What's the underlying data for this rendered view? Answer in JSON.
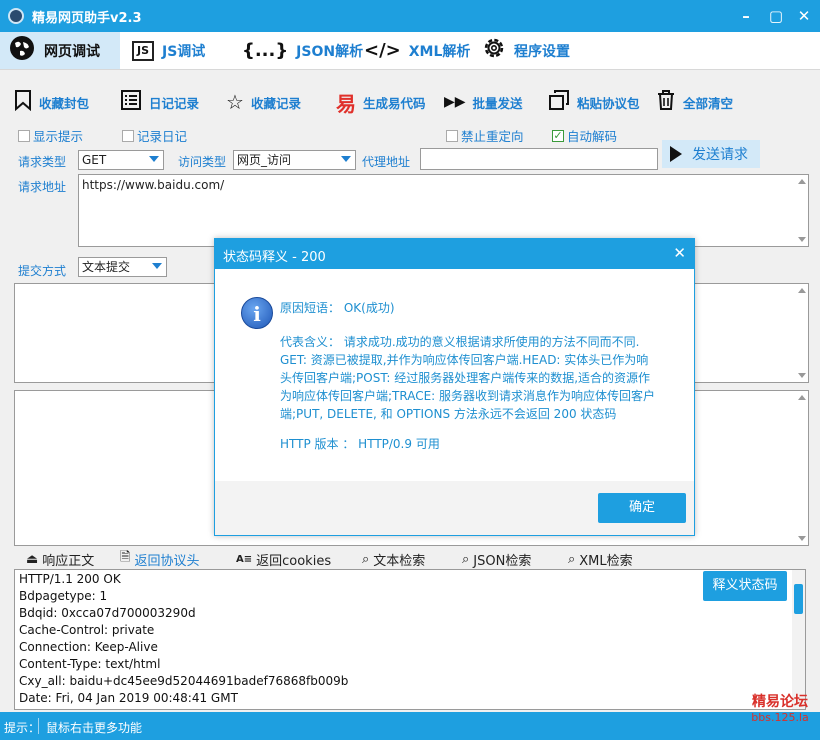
{
  "window": {
    "title": "精易网页助手v2.3"
  },
  "nav": [
    {
      "label": "网页调试",
      "icon": "globe-icon"
    },
    {
      "label": "JS调试",
      "icon": "js-icon",
      "icon_text": "JS"
    },
    {
      "label": "JSON解析",
      "icon": "json-braces-icon",
      "icon_text": "{...}"
    },
    {
      "label": "XML解析",
      "icon": "code-icon",
      "icon_text": "</>"
    },
    {
      "label": "程序设置",
      "icon": "gear-icon"
    }
  ],
  "toolbar": [
    {
      "label": "收藏封包",
      "icon": "bookmark-icon"
    },
    {
      "label": "日记记录",
      "icon": "list-icon"
    },
    {
      "label": "收藏记录",
      "icon": "star-icon"
    },
    {
      "label": "生成易代码",
      "icon": "yi-icon",
      "icon_text": "易"
    },
    {
      "label": "批量发送",
      "icon": "fast-forward-icon"
    },
    {
      "label": "粘贴协议包",
      "icon": "paste-icon"
    },
    {
      "label": "全部清空",
      "icon": "trash-icon"
    }
  ],
  "options": {
    "show_tips": {
      "label": "显示提示",
      "checked": false
    },
    "record_log": {
      "label": "记录日记",
      "checked": false
    },
    "no_redirect": {
      "label": "禁止重定向",
      "checked": false
    },
    "auto_decode": {
      "label": "自动解码",
      "checked": true
    }
  },
  "request": {
    "type_label": "请求类型",
    "type_value": "GET",
    "access_label": "访问类型",
    "access_value": "网页_访问",
    "proxy_label": "代理地址",
    "proxy_value": "",
    "send_label": "发送请求",
    "url_label": "请求地址",
    "url_value": "https://www.baidu.com/",
    "submit_label": "提交方式",
    "submit_value": "文本提交"
  },
  "result_tabs": [
    {
      "label": "响应正文",
      "icon": "response-icon"
    },
    {
      "label": "返回协议头",
      "icon": "document-icon",
      "active": true
    },
    {
      "label": "返回cookies",
      "icon": "cookie-icon"
    },
    {
      "label": "文本检索",
      "icon": "search-icon"
    },
    {
      "label": "JSON检索",
      "icon": "search-icon"
    },
    {
      "label": "XML检索",
      "icon": "search-icon"
    }
  ],
  "response_lines": [
    "HTTP/1.1 200 OK",
    "Bdpagetype: 1",
    "Bdqid: 0xcca07d700003290d",
    "Cache-Control: private",
    "Connection: Keep-Alive",
    "Content-Type: text/html",
    "Cxy_all: baidu+dc45ee9d52044691badef76868fb009b",
    "Date: Fri, 04 Jan 2019 00:48:41 GMT"
  ],
  "explain_button": "释义状态码",
  "status": {
    "prefix": "提示：",
    "text": "鼠标右击更多功能"
  },
  "watermark": {
    "line1": "精易论坛",
    "line2": "bbs.125.la"
  },
  "dialog": {
    "title": "状态码释义  -  200",
    "short_label": "原因短语：",
    "short_value": "OK(成功)",
    "meaning_lines": [
      "代表含义：  请求成功.成功的意义根据请求所使用的方法不同而不同.",
      "GET: 资源已被提取,并作为响应体传回客户端.HEAD: 实体头已作为响",
      "头传回客户端;POST: 经过服务器处理客户端传来的数据,适合的资源作",
      "为响应体传回客户端;TRACE: 服务器收到请求消息作为响应体传回客户",
      "端;PUT, DELETE, 和 OPTIONS 方法永远不会返回 200 状态码"
    ],
    "http_label": "HTTP 版本  ：",
    "http_value": "HTTP/0.9 可用",
    "ok_label": "确定"
  },
  "colors": {
    "accent": "#1e9fe0",
    "link": "#1e7fd0",
    "brand_red": "#d9302a"
  }
}
